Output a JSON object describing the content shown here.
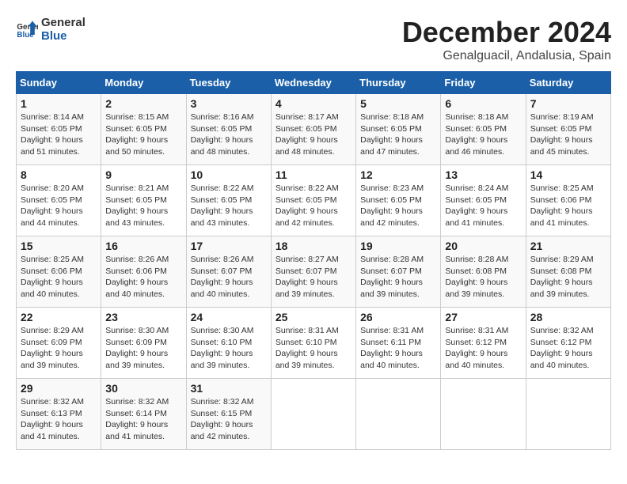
{
  "logo": {
    "line1": "General",
    "line2": "Blue"
  },
  "title": "December 2024",
  "subtitle": "Genalguacil, Andalusia, Spain",
  "weekdays": [
    "Sunday",
    "Monday",
    "Tuesday",
    "Wednesday",
    "Thursday",
    "Friday",
    "Saturday"
  ],
  "weeks": [
    [
      {
        "day": "1",
        "info": "Sunrise: 8:14 AM\nSunset: 6:05 PM\nDaylight: 9 hours\nand 51 minutes."
      },
      {
        "day": "2",
        "info": "Sunrise: 8:15 AM\nSunset: 6:05 PM\nDaylight: 9 hours\nand 50 minutes."
      },
      {
        "day": "3",
        "info": "Sunrise: 8:16 AM\nSunset: 6:05 PM\nDaylight: 9 hours\nand 48 minutes."
      },
      {
        "day": "4",
        "info": "Sunrise: 8:17 AM\nSunset: 6:05 PM\nDaylight: 9 hours\nand 48 minutes."
      },
      {
        "day": "5",
        "info": "Sunrise: 8:18 AM\nSunset: 6:05 PM\nDaylight: 9 hours\nand 47 minutes."
      },
      {
        "day": "6",
        "info": "Sunrise: 8:18 AM\nSunset: 6:05 PM\nDaylight: 9 hours\nand 46 minutes."
      },
      {
        "day": "7",
        "info": "Sunrise: 8:19 AM\nSunset: 6:05 PM\nDaylight: 9 hours\nand 45 minutes."
      }
    ],
    [
      {
        "day": "8",
        "info": "Sunrise: 8:20 AM\nSunset: 6:05 PM\nDaylight: 9 hours\nand 44 minutes."
      },
      {
        "day": "9",
        "info": "Sunrise: 8:21 AM\nSunset: 6:05 PM\nDaylight: 9 hours\nand 43 minutes."
      },
      {
        "day": "10",
        "info": "Sunrise: 8:22 AM\nSunset: 6:05 PM\nDaylight: 9 hours\nand 43 minutes."
      },
      {
        "day": "11",
        "info": "Sunrise: 8:22 AM\nSunset: 6:05 PM\nDaylight: 9 hours\nand 42 minutes."
      },
      {
        "day": "12",
        "info": "Sunrise: 8:23 AM\nSunset: 6:05 PM\nDaylight: 9 hours\nand 42 minutes."
      },
      {
        "day": "13",
        "info": "Sunrise: 8:24 AM\nSunset: 6:05 PM\nDaylight: 9 hours\nand 41 minutes."
      },
      {
        "day": "14",
        "info": "Sunrise: 8:25 AM\nSunset: 6:06 PM\nDaylight: 9 hours\nand 41 minutes."
      }
    ],
    [
      {
        "day": "15",
        "info": "Sunrise: 8:25 AM\nSunset: 6:06 PM\nDaylight: 9 hours\nand 40 minutes."
      },
      {
        "day": "16",
        "info": "Sunrise: 8:26 AM\nSunset: 6:06 PM\nDaylight: 9 hours\nand 40 minutes."
      },
      {
        "day": "17",
        "info": "Sunrise: 8:26 AM\nSunset: 6:07 PM\nDaylight: 9 hours\nand 40 minutes."
      },
      {
        "day": "18",
        "info": "Sunrise: 8:27 AM\nSunset: 6:07 PM\nDaylight: 9 hours\nand 39 minutes."
      },
      {
        "day": "19",
        "info": "Sunrise: 8:28 AM\nSunset: 6:07 PM\nDaylight: 9 hours\nand 39 minutes."
      },
      {
        "day": "20",
        "info": "Sunrise: 8:28 AM\nSunset: 6:08 PM\nDaylight: 9 hours\nand 39 minutes."
      },
      {
        "day": "21",
        "info": "Sunrise: 8:29 AM\nSunset: 6:08 PM\nDaylight: 9 hours\nand 39 minutes."
      }
    ],
    [
      {
        "day": "22",
        "info": "Sunrise: 8:29 AM\nSunset: 6:09 PM\nDaylight: 9 hours\nand 39 minutes."
      },
      {
        "day": "23",
        "info": "Sunrise: 8:30 AM\nSunset: 6:09 PM\nDaylight: 9 hours\nand 39 minutes."
      },
      {
        "day": "24",
        "info": "Sunrise: 8:30 AM\nSunset: 6:10 PM\nDaylight: 9 hours\nand 39 minutes."
      },
      {
        "day": "25",
        "info": "Sunrise: 8:31 AM\nSunset: 6:10 PM\nDaylight: 9 hours\nand 39 minutes."
      },
      {
        "day": "26",
        "info": "Sunrise: 8:31 AM\nSunset: 6:11 PM\nDaylight: 9 hours\nand 40 minutes."
      },
      {
        "day": "27",
        "info": "Sunrise: 8:31 AM\nSunset: 6:12 PM\nDaylight: 9 hours\nand 40 minutes."
      },
      {
        "day": "28",
        "info": "Sunrise: 8:32 AM\nSunset: 6:12 PM\nDaylight: 9 hours\nand 40 minutes."
      }
    ],
    [
      {
        "day": "29",
        "info": "Sunrise: 8:32 AM\nSunset: 6:13 PM\nDaylight: 9 hours\nand 41 minutes."
      },
      {
        "day": "30",
        "info": "Sunrise: 8:32 AM\nSunset: 6:14 PM\nDaylight: 9 hours\nand 41 minutes."
      },
      {
        "day": "31",
        "info": "Sunrise: 8:32 AM\nSunset: 6:15 PM\nDaylight: 9 hours\nand 42 minutes."
      },
      {
        "day": "",
        "info": ""
      },
      {
        "day": "",
        "info": ""
      },
      {
        "day": "",
        "info": ""
      },
      {
        "day": "",
        "info": ""
      }
    ]
  ]
}
